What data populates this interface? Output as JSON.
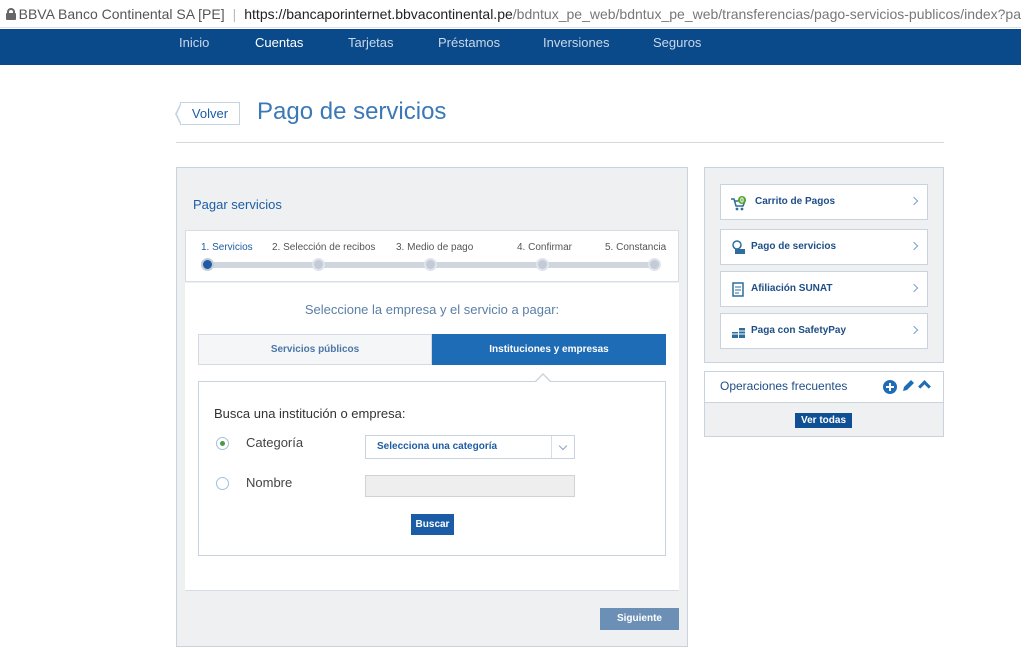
{
  "browser": {
    "site_identity": "BBVA Banco Continental SA [PE]",
    "url_host": "https://bancaporinternet.bbvacontinental.pe",
    "url_path": "/bdntux_pe_web/bdntux_pe_web/transferencias/pago-servicios-publicos/index?pa"
  },
  "nav": {
    "items": [
      "Inicio",
      "Cuentas",
      "Tarjetas",
      "Préstamos",
      "Inversiones",
      "Seguros"
    ],
    "active": "Cuentas"
  },
  "header": {
    "back_label": "Volver",
    "title": "Pago de servicios"
  },
  "main": {
    "heading": "Pagar servicios",
    "steps": [
      "1. Servicios",
      "2. Selección de recibos",
      "3. Medio de pago",
      "4. Confirmar",
      "5. Constancia"
    ],
    "active_step": 1,
    "subtitle": "Seleccione la empresa y el servicio a pagar:",
    "tabs": [
      "Servicios públicos",
      "Instituciones y empresas"
    ],
    "active_tab": "Instituciones y empresas",
    "search_title": "Busca una institución o empresa:",
    "radio_category": "Categoría",
    "radio_name": "Nombre",
    "category_select": "Selecciona una categoría",
    "search_button": "Buscar",
    "next_button": "Siguiente"
  },
  "sidebar": {
    "items": [
      {
        "label": "Carrito de Pagos",
        "icon": "cart-icon",
        "badge": "0"
      },
      {
        "label": "Pago de servicios",
        "icon": "service-payment-icon"
      },
      {
        "label": "Afiliación SUNAT",
        "icon": "document-icon"
      },
      {
        "label": "Paga con SafetyPay",
        "icon": "coins-icon"
      }
    ],
    "frequent_title": "Operaciones frecuentes",
    "view_all": "Ver todas"
  },
  "colors": {
    "nav_bg": "#0a4a8b",
    "accent": "#1e6cb6",
    "title": "#3b78b8"
  }
}
